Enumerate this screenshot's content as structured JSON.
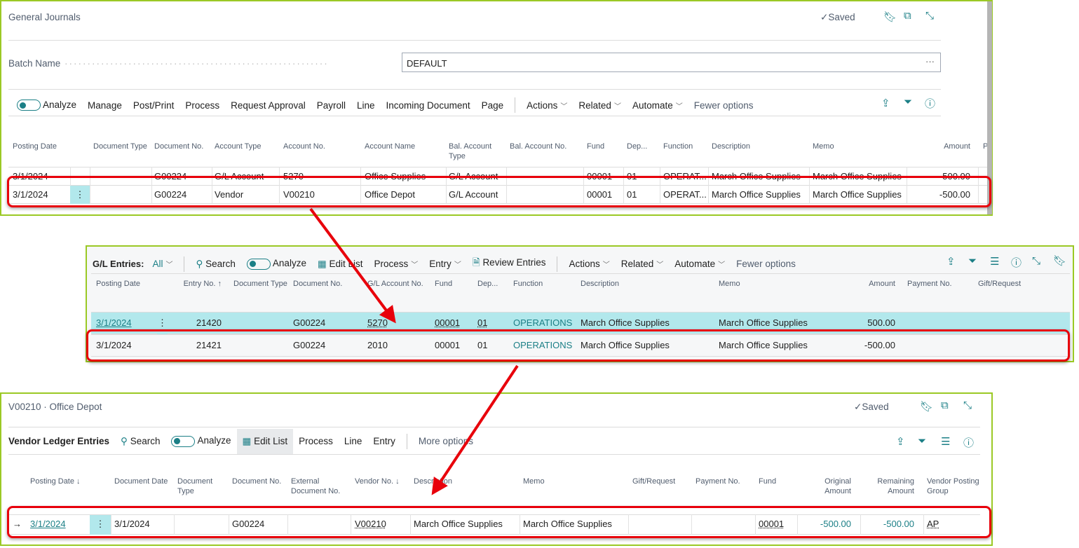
{
  "journal": {
    "title": "General Journals",
    "saved": "Saved",
    "batch_label": "Batch Name",
    "batch_value": "DEFAULT",
    "toolbar": [
      "Analyze",
      "Manage",
      "Post/Print",
      "Process",
      "Request Approval",
      "Payroll",
      "Line",
      "Incoming Document",
      "Page"
    ],
    "toolbar_dropdowns": [
      "Actions",
      "Related",
      "Automate"
    ],
    "fewer_options": "Fewer options",
    "headers": [
      "Posting Date",
      "",
      "Document Type",
      "Document No.",
      "Account Type",
      "Account No.",
      "Account Name",
      "Bal. Account Type",
      "Bal. Account No.",
      "Fund",
      "Dep...",
      "Function",
      "Description",
      "Memo",
      "Amount",
      "P"
    ],
    "rows": [
      [
        "3/1/2024",
        "",
        "",
        "G00224",
        "G/L Account",
        "5270",
        "Office Supplies",
        "G/L Account",
        "",
        "00001",
        "01",
        "OPERAT...",
        "March Office Supplies",
        "March Office Supplies",
        "500.00",
        ""
      ],
      [
        "3/1/2024",
        "⋮",
        "",
        "G00224",
        "Vendor",
        "V00210",
        "Office Depot",
        "G/L Account",
        "",
        "00001",
        "01",
        "OPERAT...",
        "March Office Supplies",
        "March Office Supplies",
        "-500.00",
        ""
      ]
    ]
  },
  "gl_entries": {
    "title": "G/L Entries:",
    "filter": "All",
    "toolbar": [
      "Search",
      "Analyze",
      "Edit List",
      "Process",
      "Entry",
      "Review Entries"
    ],
    "toolbar_dropdowns": [
      "Actions",
      "Related",
      "Automate"
    ],
    "fewer_options": "Fewer options",
    "headers": [
      "Posting Date",
      "",
      "Entry No. ↑",
      "Document Type",
      "Document No.",
      "G/L Account No.",
      "Fund",
      "Dep...",
      "Function",
      "Description",
      "Memo",
      "Amount",
      "Payment No.",
      "Gift/Request"
    ],
    "rows": [
      [
        "3/1/2024",
        "⋮",
        "21420",
        "",
        "G00224",
        "5270",
        "00001",
        "01",
        "OPERATIONS",
        "March Office Supplies",
        "March Office Supplies",
        "500.00",
        "",
        ""
      ],
      [
        "3/1/2024",
        "",
        "21421",
        "",
        "G00224",
        "2010",
        "00001",
        "01",
        "OPERATIONS",
        "March Office Supplies",
        "March Office Supplies",
        "-500.00",
        "",
        ""
      ]
    ]
  },
  "vendor": {
    "title": "V00210 · Office Depot",
    "saved": "Saved",
    "list_title": "Vendor Ledger Entries",
    "toolbar": [
      "Search",
      "Analyze",
      "Edit List",
      "Process",
      "Line",
      "Entry"
    ],
    "more_options": "More options",
    "headers": [
      "",
      "Posting Date ↓",
      "",
      "Document Date",
      "Document Type",
      "Document No.",
      "External Document No.",
      "Vendor No. ↓",
      "Description",
      "Memo",
      "Gift/Request",
      "Payment No.",
      "Fund",
      "Original Amount",
      "Remaining Amount",
      "Vendor Posting Group"
    ],
    "rows": [
      [
        "→",
        "3/1/2024",
        "⋮",
        "3/1/2024",
        "",
        "G00224",
        "",
        "V00210",
        "March Office Supplies",
        "March Office Supplies",
        "",
        "",
        "00001",
        "-500.00",
        "-500.00",
        "AP"
      ]
    ]
  },
  "colors": {
    "accent": "#1b7f86",
    "highlight_row": "#b2e8ec",
    "annotation": "#e8000b",
    "panel_border": "#9bc925"
  }
}
